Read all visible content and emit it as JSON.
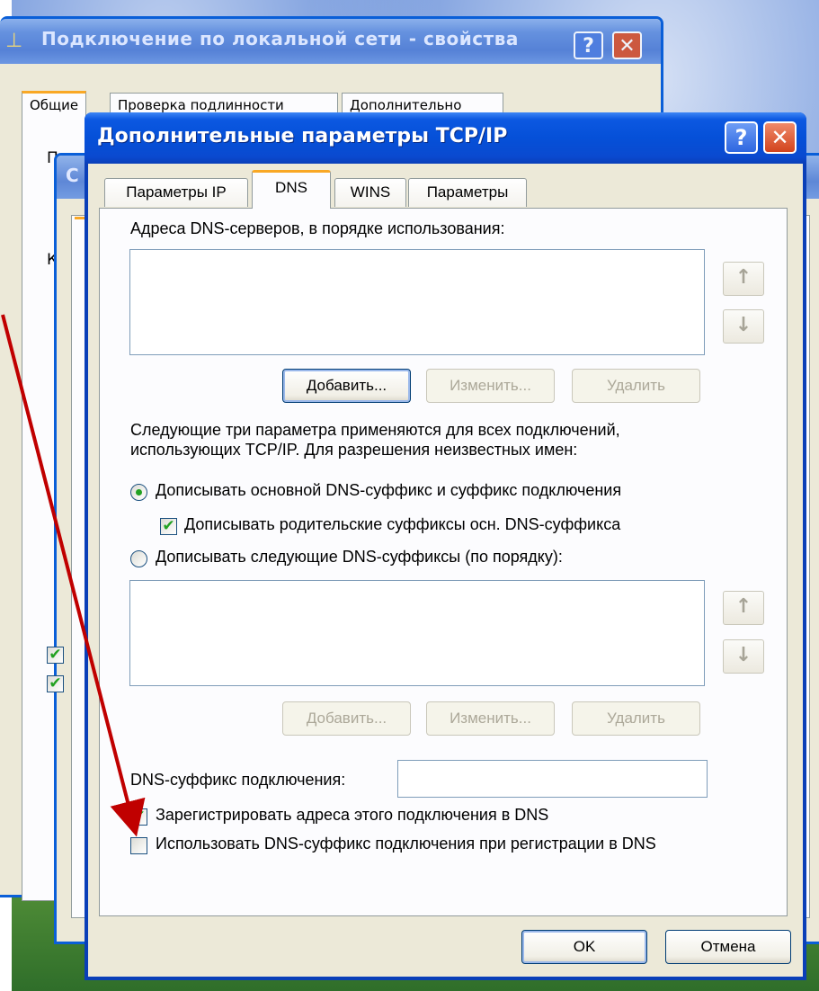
{
  "background_window": {
    "title": "Подключение по локальной сети - свойства",
    "help_label": "?",
    "close_label": "✕",
    "tabs": [
      "Общие",
      "Проверка подлинности",
      "Дополнительно"
    ],
    "fragments": [
      "П",
      "К"
    ]
  },
  "middle_window": {
    "title_fragment": "С"
  },
  "dialog": {
    "title": "Дополнительные параметры TCP/IP",
    "help_label": "?",
    "close_label": "✕",
    "tabs": [
      "Параметры IP",
      "DNS",
      "WINS",
      "Параметры"
    ],
    "active_tab": "DNS",
    "dns_servers_label": "Адреса DNS-серверов, в порядке использования:",
    "dns_servers": [],
    "up_label": "↑",
    "down_label": "↓",
    "add_label": "Добавить...",
    "edit_label": "Изменить...",
    "remove_label": "Удалить",
    "info_line1": "Следующие три параметра применяются для всех подключений,",
    "info_line2": "использующих TCP/IP. Для разрешения неизвестных имен:",
    "radio_primary_label": "Дописывать основной DNS-суффикс и суффикс подключения",
    "radio_primary_checked": true,
    "check_parent_label": "Дописывать родительские суффиксы осн. DNS-суффикса",
    "check_parent_checked": true,
    "radio_specific_label": "Дописывать следующие DNS-суффиксы (по порядку):",
    "radio_specific_checked": false,
    "suffix_list": [],
    "connection_suffix_label": "DNS-суффикс подключения:",
    "connection_suffix_value": "",
    "check_register_label": "Зарегистрировать адреса этого подключения в DNS",
    "check_register_checked": true,
    "check_use_suffix_label": "Использовать DNS-суффикс подключения при регистрации в DNS",
    "check_use_suffix_checked": false,
    "ok_label": "OK",
    "cancel_label": "Отмена",
    "check_mark": "✔"
  },
  "colors": {
    "annotation_arrow": "#c00000",
    "titlebar": "#0550d8",
    "dialog_face": "#ece9d8",
    "check_green": "#21a121"
  },
  "icons": [
    "network-connection-icon",
    "help-icon",
    "close-icon",
    "arrow-up-icon",
    "arrow-down-icon",
    "annotation-arrow-icon"
  ]
}
